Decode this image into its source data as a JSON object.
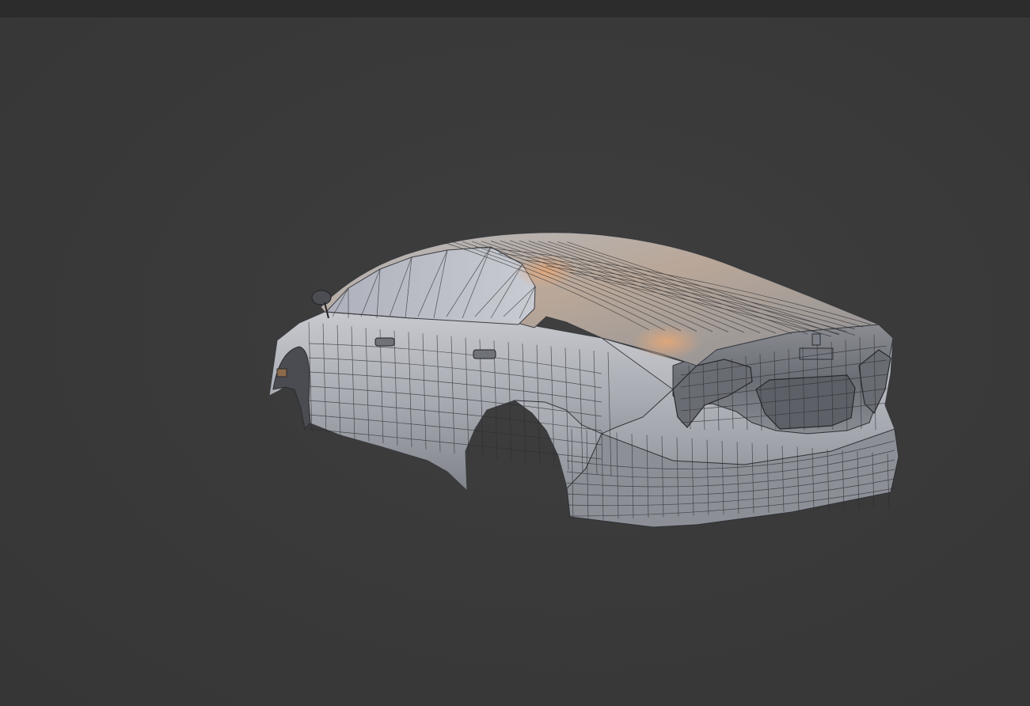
{
  "app": {
    "view": "3d-viewport",
    "object": "car-body-mesh",
    "shading": "solid",
    "wireframe_overlay": true
  },
  "colors": {
    "background": "#3a3a3a",
    "header": "#2c2c2c",
    "mesh_base": "#9ea2ab",
    "mesh_shadow": "#5e6169",
    "highlight": "#d8a27a",
    "wire": "#2a2c30"
  }
}
